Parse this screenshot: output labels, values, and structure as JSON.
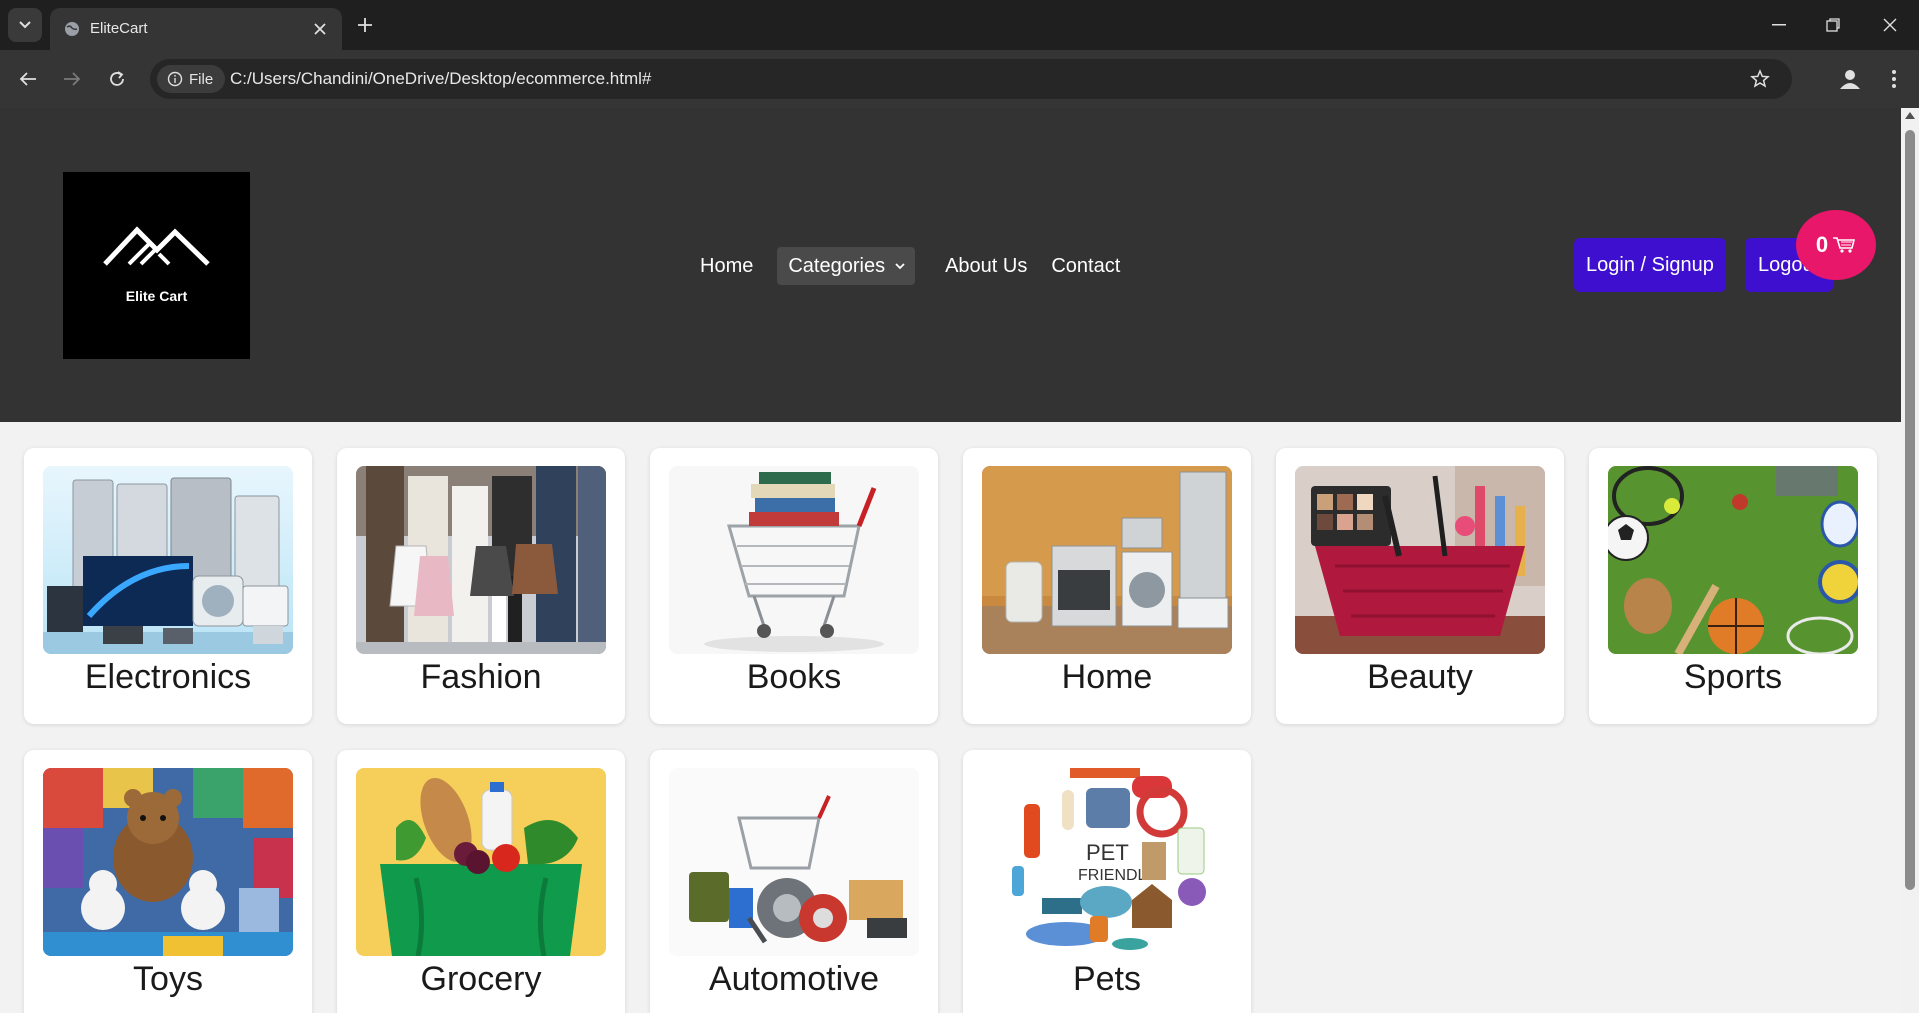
{
  "browser": {
    "tab_title": "EliteCart",
    "site_chip_label": "File",
    "url": "C:/Users/Chandini/OneDrive/Desktop/ecommerce.html#"
  },
  "header": {
    "logo_text": "Elite Cart",
    "nav": {
      "home": "Home",
      "categories": "Categories",
      "about": "About Us",
      "contact": "Contact"
    },
    "login_label": "Login / Signup",
    "logout_label": "Logout",
    "cart_count": "0"
  },
  "categories": [
    {
      "label": "Electronics",
      "icon": "electronics-image"
    },
    {
      "label": "Fashion",
      "icon": "fashion-image"
    },
    {
      "label": "Books",
      "icon": "books-image"
    },
    {
      "label": "Home",
      "icon": "home-appliances-image"
    },
    {
      "label": "Beauty",
      "icon": "beauty-image"
    },
    {
      "label": "Sports",
      "icon": "sports-image"
    },
    {
      "label": "Toys",
      "icon": "toys-image"
    },
    {
      "label": "Grocery",
      "icon": "grocery-image"
    },
    {
      "label": "Automotive",
      "icon": "automotive-image"
    },
    {
      "label": "Pets",
      "icon": "pets-image"
    }
  ],
  "colors": {
    "header_bg": "#333333",
    "button_bg": "#3f0fd0",
    "cart_badge": "#e8176a",
    "page_bg": "#f2f2f2"
  }
}
